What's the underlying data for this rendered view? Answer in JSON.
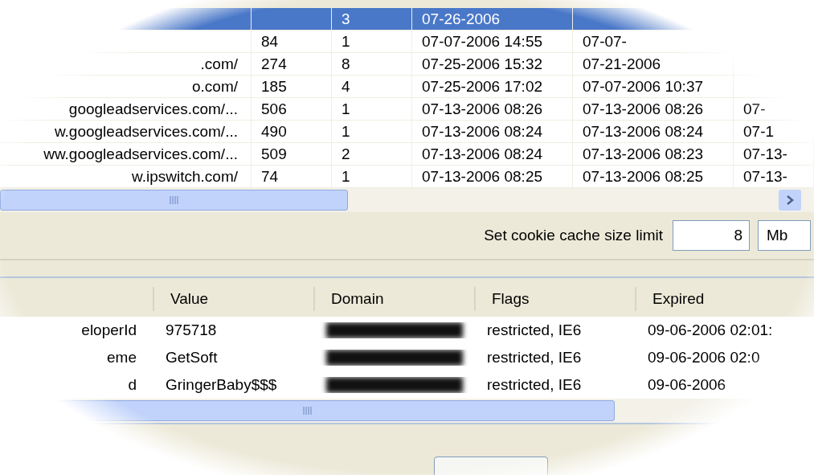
{
  "top_table": {
    "rows": [
      {
        "selected": true,
        "cells": [
          "",
          "",
          "3",
          "07-26-2006",
          "",
          ""
        ]
      },
      {
        "selected": false,
        "cells": [
          "",
          "84",
          "1",
          "07-07-2006  14:55",
          "07-07-",
          ""
        ]
      },
      {
        "selected": false,
        "cells": [
          ".com/",
          "274",
          "8",
          "07-25-2006  15:32",
          "07-21-2006",
          ""
        ]
      },
      {
        "selected": false,
        "cells": [
          "o.com/",
          "185",
          "4",
          "07-25-2006  17:02",
          "07-07-2006  10:37",
          ""
        ]
      },
      {
        "selected": false,
        "cells": [
          "googleadservices.com/...",
          "506",
          "1",
          "07-13-2006  08:26",
          "07-13-2006  08:26",
          "07-"
        ]
      },
      {
        "selected": false,
        "cells": [
          "w.googleadservices.com/...",
          "490",
          "1",
          "07-13-2006  08:24",
          "07-13-2006  08:24",
          "07-1"
        ]
      },
      {
        "selected": false,
        "cells": [
          "ww.googleadservices.com/...",
          "509",
          "2",
          "07-13-2006  08:24",
          "07-13-2006  08:23",
          "07-13-"
        ]
      },
      {
        "selected": false,
        "cells": [
          "w.ipswitch.com/",
          "74",
          "1",
          "07-13-2006  08:25",
          "07-13-2006  08:25",
          "07-13-"
        ]
      }
    ]
  },
  "cache_limit": {
    "label": "Set cookie cache size limit",
    "value": "8",
    "unit": "Mb"
  },
  "bottom_table": {
    "columns": [
      "",
      "Value",
      "Domain",
      "Flags",
      "Expired"
    ],
    "rows": [
      {
        "cells": [
          "eloperId",
          "975718",
          "",
          "restricted, IE6",
          "09-06-2006  02:01:"
        ]
      },
      {
        "cells": [
          "eme",
          "GetSoft",
          "",
          "restricted, IE6",
          "09-06-2006  02:0"
        ]
      },
      {
        "cells": [
          "d",
          "GringerBaby$$$",
          "",
          "restricted, IE6",
          "09-06-2006"
        ]
      }
    ]
  }
}
